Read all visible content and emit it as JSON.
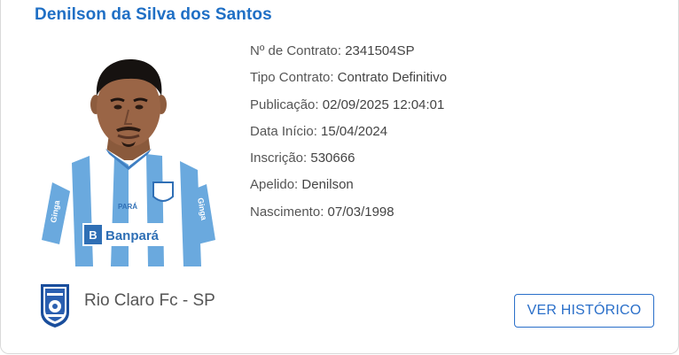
{
  "player": {
    "name": "Denilson da Silva dos Santos"
  },
  "contract": {
    "numero_label": "Nº de Contrato:",
    "numero_value": "2341504SP",
    "tipo_label": "Tipo Contrato:",
    "tipo_value": "Contrato Definitivo",
    "publicacao_label": "Publicação:",
    "publicacao_value": "02/09/2025 12:04:01",
    "inicio_label": "Data Início:",
    "inicio_value": "15/04/2024",
    "inscricao_label": "Inscrição:",
    "inscricao_value": "530666",
    "apelido_label": "Apelido:",
    "apelido_value": "Denilson",
    "nascimento_label": "Nascimento:",
    "nascimento_value": "07/03/1998"
  },
  "shirt": {
    "sponsor": "Banpará",
    "sleeve_brand": "Ginga",
    "chest_small": "PARÁ"
  },
  "club": {
    "name": "Rio Claro Fc - SP",
    "logo_icon": "club-crest-icon"
  },
  "actions": {
    "history_button": "VER HISTÓRICO"
  },
  "colors": {
    "title_blue": "#1f6fc5",
    "button_blue": "#2a6fc9",
    "text_gray": "#555555",
    "shirt_blue": "#6aa9de"
  }
}
